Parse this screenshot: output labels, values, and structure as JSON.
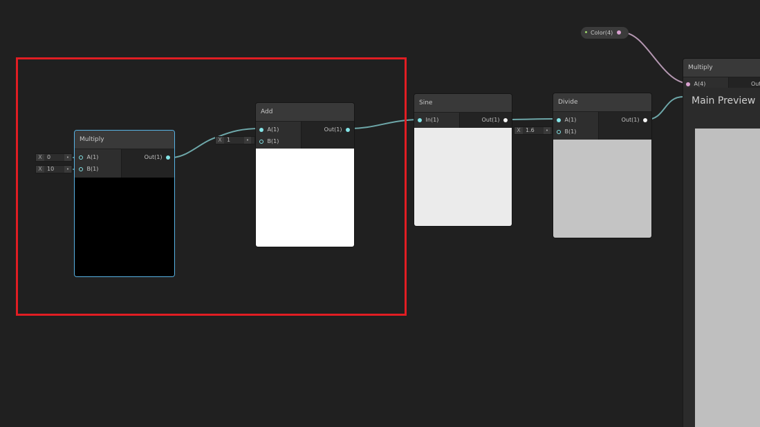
{
  "nodes": {
    "multiply1": {
      "title": "Multiply",
      "input_a": "A(1)",
      "input_b": "B(1)",
      "output": "Out(1)",
      "preview_color": "#000000"
    },
    "add": {
      "title": "Add",
      "input_a": "A(1)",
      "input_b": "B(1)",
      "output": "Out(1)",
      "preview_color": "#ffffff"
    },
    "sine": {
      "title": "Sine",
      "input": "In(1)",
      "output": "Out(1)",
      "preview_color": "#ebebeb"
    },
    "divide": {
      "title": "Divide",
      "input_a": "A(1)",
      "input_b": "B(1)",
      "output": "Out(1)",
      "preview_color": "#c4c4c4"
    },
    "multiply2": {
      "title": "Multiply",
      "input_a": "A(4)",
      "output": "Out"
    }
  },
  "fields": {
    "multiply1_a": {
      "axis": "X",
      "value": "0"
    },
    "multiply1_b": {
      "axis": "X",
      "value": "10"
    },
    "add_b": {
      "axis": "X",
      "value": "1"
    },
    "divide_b": {
      "axis": "X",
      "value": "1.6"
    }
  },
  "color_property": {
    "label": "Color(4)"
  },
  "main_preview": {
    "title": "Main Preview",
    "preview_color": "#bfbfbf"
  },
  "colors": {
    "background": "#202020",
    "wire_float": "#6ea8aa",
    "wire_color": "#b497b1",
    "selection": "#e11d23",
    "node_selected_border": "#58b4e6"
  },
  "icons": {
    "port_input": "hollow-circle",
    "port_output": "filled-circle",
    "connection_dot": "small-dot"
  }
}
